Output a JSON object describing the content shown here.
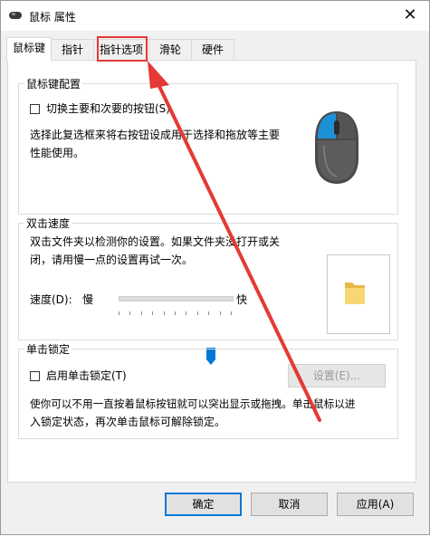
{
  "window": {
    "title": "鼠标 属性",
    "close_symbol": "✕"
  },
  "tabs": [
    {
      "label": "鼠标键",
      "active": true
    },
    {
      "label": "指针",
      "active": false
    },
    {
      "label": "指针选项",
      "active": false
    },
    {
      "label": "滑轮",
      "active": false
    },
    {
      "label": "硬件",
      "active": false
    }
  ],
  "button_config": {
    "title": "鼠标键配置",
    "checkbox_label": "切换主要和次要的按钮(S)",
    "description_line1": "选择此复选框来将右按钮设成用于选择和拖放等主要",
    "description_line2": "性能使用。",
    "checked": false
  },
  "double_click": {
    "title": "双击速度",
    "description_line1": "双击文件夹以检测你的设置。如果文件夹没打开或关",
    "description_line2": "闭，请用慢一点的设置再试一次。",
    "speed_label": "速度(D):",
    "slow_label": "慢",
    "fast_label": "快",
    "speed_level": 0.76
  },
  "click_lock": {
    "title": "单击锁定",
    "checkbox_label": "启用单击锁定(T)",
    "settings_button": "设置(E)...",
    "description_line1": "使你可以不用一直按着鼠标按钮就可以突出显示或拖拽。单击鼠标以进",
    "description_line2": "入锁定状态，再次单击鼠标可解除锁定。",
    "checked": false
  },
  "footer": {
    "ok": "确定",
    "cancel": "取消",
    "apply": "应用(A)"
  },
  "colors": {
    "accent": "#0078d7",
    "highlight_red": "#e53935"
  }
}
